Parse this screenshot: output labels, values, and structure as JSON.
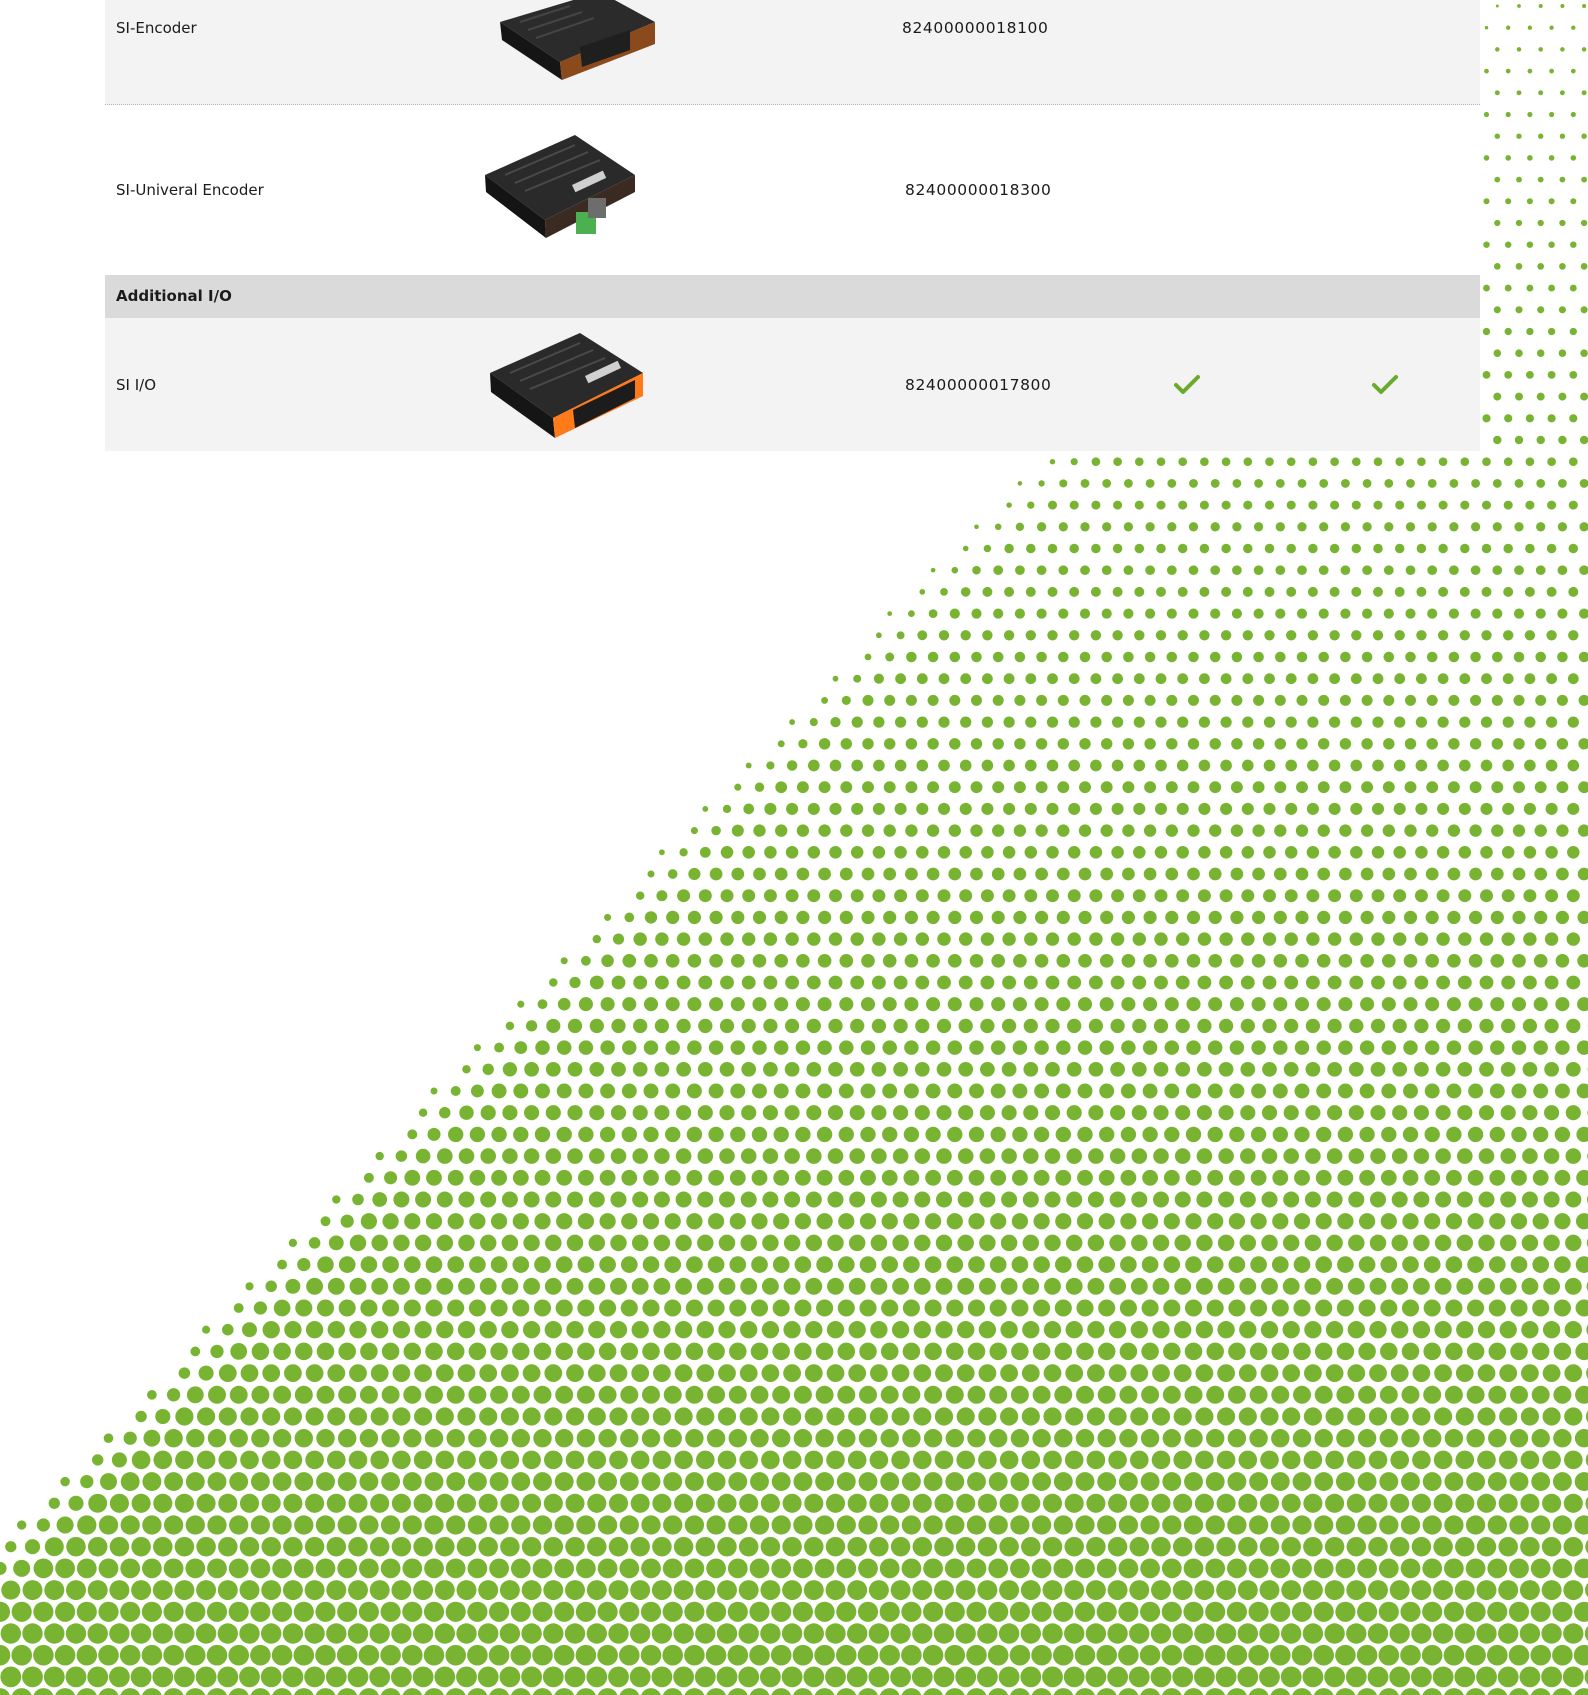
{
  "colors": {
    "dot_green": "#78b432",
    "row_shaded": "#f3f3f3",
    "section_header_bg": "#dadada",
    "check_green": "#6aaa2c"
  },
  "table": {
    "rows": [
      {
        "name": "SI-Encoder",
        "image_icon": "encoder-module-image",
        "part_number": "82400000018100"
      },
      {
        "name": "SI-Univeral Encoder",
        "image_icon": "universal-encoder-module-image",
        "part_number": "82400000018300"
      }
    ],
    "section": {
      "title": "Additional I/O",
      "rows": [
        {
          "name": "SI I/O",
          "image_icon": "io-module-image",
          "part_number": "82400000017800",
          "check_icons": [
            "check-icon",
            "check-icon"
          ]
        }
      ]
    }
  }
}
